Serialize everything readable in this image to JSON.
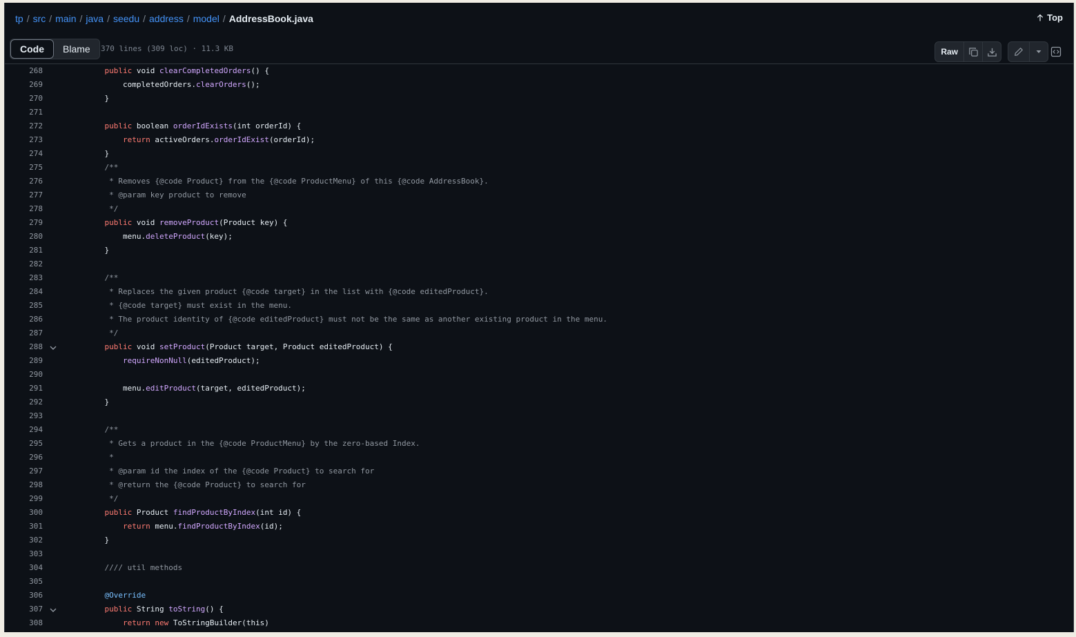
{
  "breadcrumb": {
    "parts": [
      "tp",
      "src",
      "main",
      "java",
      "seedu",
      "address",
      "model"
    ],
    "file": "AddressBook.java",
    "separator": "/"
  },
  "top_link": "Top",
  "tabs": {
    "code": "Code",
    "blame": "Blame"
  },
  "file_meta": "370 lines (309 loc) · 11.3 KB",
  "toolbar": {
    "raw_label": "Raw",
    "copy_icon": "copy-icon",
    "download_icon": "download-icon",
    "edit_icon": "pencil-icon",
    "more_icon": "triangle-down-icon",
    "symbols_icon": "code-square-icon"
  },
  "colors": {
    "background": "#0d1117",
    "keyword": "#ff7b72",
    "function": "#d2a8ff",
    "comment": "#9198a1",
    "annotation": "#79c0ff",
    "link": "#4493f8"
  },
  "lines": [
    {
      "n": "268",
      "fold": false,
      "tokens": [
        [
          "",
          "    "
        ],
        [
          "kw",
          "public"
        ],
        [
          "",
          " void "
        ],
        [
          "fn",
          "clearCompletedOrders"
        ],
        [
          "",
          "() {"
        ]
      ]
    },
    {
      "n": "269",
      "fold": false,
      "tokens": [
        [
          "",
          "        completedOrders."
        ],
        [
          "fn",
          "clearOrders"
        ],
        [
          "",
          "();"
        ]
      ]
    },
    {
      "n": "270",
      "fold": false,
      "tokens": [
        [
          "",
          "    }"
        ]
      ]
    },
    {
      "n": "271",
      "fold": false,
      "tokens": []
    },
    {
      "n": "272",
      "fold": false,
      "tokens": [
        [
          "",
          "    "
        ],
        [
          "kw",
          "public"
        ],
        [
          "",
          " boolean "
        ],
        [
          "fn",
          "orderIdExists"
        ],
        [
          "",
          "(int orderId) {"
        ]
      ]
    },
    {
      "n": "273",
      "fold": false,
      "tokens": [
        [
          "",
          "        "
        ],
        [
          "kw",
          "return"
        ],
        [
          "",
          " activeOrders."
        ],
        [
          "fn",
          "orderIdExist"
        ],
        [
          "",
          "(orderId);"
        ]
      ]
    },
    {
      "n": "274",
      "fold": false,
      "tokens": [
        [
          "",
          "    }"
        ]
      ]
    },
    {
      "n": "275",
      "fold": false,
      "tokens": [
        [
          "cm",
          "    /**"
        ]
      ]
    },
    {
      "n": "276",
      "fold": false,
      "tokens": [
        [
          "cm",
          "     * Removes {@code Product} from the {@code ProductMenu} of this {@code AddressBook}."
        ]
      ]
    },
    {
      "n": "277",
      "fold": false,
      "tokens": [
        [
          "cm",
          "     * @param key product to remove"
        ]
      ]
    },
    {
      "n": "278",
      "fold": false,
      "tokens": [
        [
          "cm",
          "     */"
        ]
      ]
    },
    {
      "n": "279",
      "fold": false,
      "tokens": [
        [
          "",
          "    "
        ],
        [
          "kw",
          "public"
        ],
        [
          "",
          " void "
        ],
        [
          "fn",
          "removeProduct"
        ],
        [
          "",
          "(Product key) {"
        ]
      ]
    },
    {
      "n": "280",
      "fold": false,
      "tokens": [
        [
          "",
          "        menu."
        ],
        [
          "fn",
          "deleteProduct"
        ],
        [
          "",
          "(key);"
        ]
      ]
    },
    {
      "n": "281",
      "fold": false,
      "tokens": [
        [
          "",
          "    }"
        ]
      ]
    },
    {
      "n": "282",
      "fold": false,
      "tokens": []
    },
    {
      "n": "283",
      "fold": false,
      "tokens": [
        [
          "cm",
          "    /**"
        ]
      ]
    },
    {
      "n": "284",
      "fold": false,
      "tokens": [
        [
          "cm",
          "     * Replaces the given product {@code target} in the list with {@code editedProduct}."
        ]
      ]
    },
    {
      "n": "285",
      "fold": false,
      "tokens": [
        [
          "cm",
          "     * {@code target} must exist in the menu."
        ]
      ]
    },
    {
      "n": "286",
      "fold": false,
      "tokens": [
        [
          "cm",
          "     * The product identity of {@code editedProduct} must not be the same as another existing product in the menu."
        ]
      ]
    },
    {
      "n": "287",
      "fold": false,
      "tokens": [
        [
          "cm",
          "     */"
        ]
      ]
    },
    {
      "n": "288",
      "fold": true,
      "tokens": [
        [
          "",
          "    "
        ],
        [
          "kw",
          "public"
        ],
        [
          "",
          " void "
        ],
        [
          "fn",
          "setProduct"
        ],
        [
          "",
          "(Product target, Product editedProduct) {"
        ]
      ]
    },
    {
      "n": "289",
      "fold": false,
      "tokens": [
        [
          "",
          "        "
        ],
        [
          "fn",
          "requireNonNull"
        ],
        [
          "",
          "(editedProduct);"
        ]
      ]
    },
    {
      "n": "290",
      "fold": false,
      "tokens": []
    },
    {
      "n": "291",
      "fold": false,
      "tokens": [
        [
          "",
          "        menu."
        ],
        [
          "fn",
          "editProduct"
        ],
        [
          "",
          "(target, editedProduct);"
        ]
      ]
    },
    {
      "n": "292",
      "fold": false,
      "tokens": [
        [
          "",
          "    }"
        ]
      ]
    },
    {
      "n": "293",
      "fold": false,
      "tokens": []
    },
    {
      "n": "294",
      "fold": false,
      "tokens": [
        [
          "cm",
          "    /**"
        ]
      ]
    },
    {
      "n": "295",
      "fold": false,
      "tokens": [
        [
          "cm",
          "     * Gets a product in the {@code ProductMenu} by the zero-based Index."
        ]
      ]
    },
    {
      "n": "296",
      "fold": false,
      "tokens": [
        [
          "cm",
          "     *"
        ]
      ]
    },
    {
      "n": "297",
      "fold": false,
      "tokens": [
        [
          "cm",
          "     * @param id the index of the {@code Product} to search for"
        ]
      ]
    },
    {
      "n": "298",
      "fold": false,
      "tokens": [
        [
          "cm",
          "     * @return the {@code Product} to search for"
        ]
      ]
    },
    {
      "n": "299",
      "fold": false,
      "tokens": [
        [
          "cm",
          "     */"
        ]
      ]
    },
    {
      "n": "300",
      "fold": false,
      "tokens": [
        [
          "",
          "    "
        ],
        [
          "kw",
          "public"
        ],
        [
          "",
          " Product "
        ],
        [
          "fn",
          "findProductByIndex"
        ],
        [
          "",
          "(int id) {"
        ]
      ]
    },
    {
      "n": "301",
      "fold": false,
      "tokens": [
        [
          "",
          "        "
        ],
        [
          "kw",
          "return"
        ],
        [
          "",
          " menu."
        ],
        [
          "fn",
          "findProductByIndex"
        ],
        [
          "",
          "(id);"
        ]
      ]
    },
    {
      "n": "302",
      "fold": false,
      "tokens": [
        [
          "",
          "    }"
        ]
      ]
    },
    {
      "n": "303",
      "fold": false,
      "tokens": []
    },
    {
      "n": "304",
      "fold": false,
      "tokens": [
        [
          "cm",
          "    //// util methods"
        ]
      ]
    },
    {
      "n": "305",
      "fold": false,
      "tokens": []
    },
    {
      "n": "306",
      "fold": false,
      "tokens": [
        [
          "",
          "    "
        ],
        [
          "an",
          "@Override"
        ]
      ]
    },
    {
      "n": "307",
      "fold": true,
      "tokens": [
        [
          "",
          "    "
        ],
        [
          "kw",
          "public"
        ],
        [
          "",
          " String "
        ],
        [
          "fn",
          "toString"
        ],
        [
          "",
          "() {"
        ]
      ]
    },
    {
      "n": "308",
      "fold": false,
      "tokens": [
        [
          "",
          "        "
        ],
        [
          "kw",
          "return"
        ],
        [
          "",
          " "
        ],
        [
          "kw",
          "new"
        ],
        [
          "",
          " ToStringBuilder(this)"
        ]
      ]
    }
  ]
}
